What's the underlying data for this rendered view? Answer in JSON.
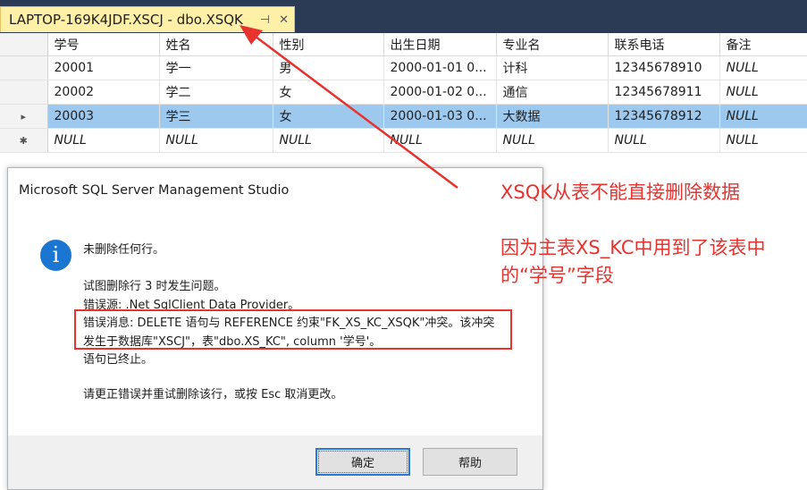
{
  "tab": {
    "title": "LAPTOP-169K4JDF.XSCJ - dbo.XSQK",
    "pin_glyph": "⊣",
    "close_glyph": "✕"
  },
  "grid": {
    "columns": [
      "学号",
      "姓名",
      "性别",
      "出生日期",
      "专业名",
      "联系电话",
      "备注"
    ],
    "rows": [
      {
        "marker": "",
        "cells": [
          "20001",
          "学一",
          "男",
          "2000-01-01 0...",
          "计科",
          "12345678910",
          "NULL"
        ]
      },
      {
        "marker": "",
        "cells": [
          "20002",
          "学二",
          "女",
          "2000-01-02 0...",
          "通信",
          "12345678911",
          "NULL"
        ]
      },
      {
        "marker": "▸",
        "cells": [
          "20003",
          "学三",
          "女",
          "2000-01-03 0...",
          "大数据",
          "12345678912",
          "NULL"
        ]
      },
      {
        "marker": "✱",
        "cells": [
          "NULL",
          "NULL",
          "NULL",
          "NULL",
          "NULL",
          "NULL",
          "NULL"
        ]
      }
    ],
    "selected_row": 2
  },
  "dialog": {
    "title": "Microsoft SQL Server Management Studio",
    "icon": "info-icon",
    "line1": "未删除任何行。",
    "line2": "试图删除行 3 时发生问题。",
    "line3": "错误源: .Net SqlClient Data Provider。",
    "line4": "错误消息: DELETE 语句与 REFERENCE 约束\"FK_XS_KC_XSQK\"冲突。该冲突",
    "line5": "发生于数据库\"XSCJ\"，表\"dbo.XS_KC\", column '学号'。",
    "line6": "语句已终止。",
    "line7": "请更正错误并重试删除该行，或按 Esc 取消更改。",
    "ok_label": "确定",
    "help_label": "帮助"
  },
  "annotations": {
    "note1": "XSQK从表不能直接删除数据",
    "note2": "因为主表XS_KC中用到了该表中",
    "note3": "的“学号”字段",
    "color": "#e8322e"
  },
  "colors": {
    "tab_background": "#fff0a8",
    "tab_strip": "#2b3a55",
    "selected_row": "#9ec9ef",
    "info_icon": "#1b76d2",
    "primary_button_border": "#2a78d6"
  }
}
